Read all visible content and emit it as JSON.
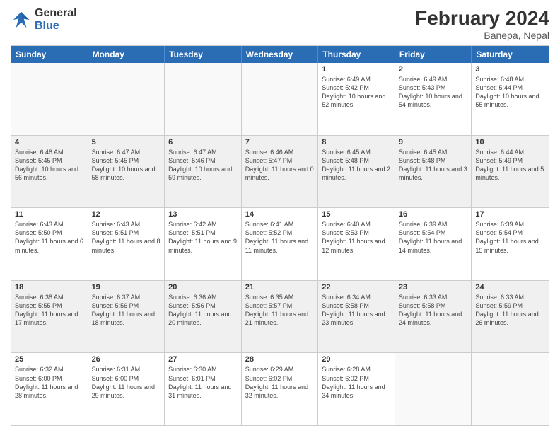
{
  "header": {
    "logo_general": "General",
    "logo_blue": "Blue",
    "title": "February 2024",
    "subtitle": "Banepa, Nepal"
  },
  "days_of_week": [
    "Sunday",
    "Monday",
    "Tuesday",
    "Wednesday",
    "Thursday",
    "Friday",
    "Saturday"
  ],
  "weeks": [
    [
      {
        "day": "",
        "info": ""
      },
      {
        "day": "",
        "info": ""
      },
      {
        "day": "",
        "info": ""
      },
      {
        "day": "",
        "info": ""
      },
      {
        "day": "1",
        "info": "Sunrise: 6:49 AM\nSunset: 5:42 PM\nDaylight: 10 hours and 52 minutes."
      },
      {
        "day": "2",
        "info": "Sunrise: 6:49 AM\nSunset: 5:43 PM\nDaylight: 10 hours and 54 minutes."
      },
      {
        "day": "3",
        "info": "Sunrise: 6:48 AM\nSunset: 5:44 PM\nDaylight: 10 hours and 55 minutes."
      }
    ],
    [
      {
        "day": "4",
        "info": "Sunrise: 6:48 AM\nSunset: 5:45 PM\nDaylight: 10 hours and 56 minutes."
      },
      {
        "day": "5",
        "info": "Sunrise: 6:47 AM\nSunset: 5:45 PM\nDaylight: 10 hours and 58 minutes."
      },
      {
        "day": "6",
        "info": "Sunrise: 6:47 AM\nSunset: 5:46 PM\nDaylight: 10 hours and 59 minutes."
      },
      {
        "day": "7",
        "info": "Sunrise: 6:46 AM\nSunset: 5:47 PM\nDaylight: 11 hours and 0 minutes."
      },
      {
        "day": "8",
        "info": "Sunrise: 6:45 AM\nSunset: 5:48 PM\nDaylight: 11 hours and 2 minutes."
      },
      {
        "day": "9",
        "info": "Sunrise: 6:45 AM\nSunset: 5:48 PM\nDaylight: 11 hours and 3 minutes."
      },
      {
        "day": "10",
        "info": "Sunrise: 6:44 AM\nSunset: 5:49 PM\nDaylight: 11 hours and 5 minutes."
      }
    ],
    [
      {
        "day": "11",
        "info": "Sunrise: 6:43 AM\nSunset: 5:50 PM\nDaylight: 11 hours and 6 minutes."
      },
      {
        "day": "12",
        "info": "Sunrise: 6:43 AM\nSunset: 5:51 PM\nDaylight: 11 hours and 8 minutes."
      },
      {
        "day": "13",
        "info": "Sunrise: 6:42 AM\nSunset: 5:51 PM\nDaylight: 11 hours and 9 minutes."
      },
      {
        "day": "14",
        "info": "Sunrise: 6:41 AM\nSunset: 5:52 PM\nDaylight: 11 hours and 11 minutes."
      },
      {
        "day": "15",
        "info": "Sunrise: 6:40 AM\nSunset: 5:53 PM\nDaylight: 11 hours and 12 minutes."
      },
      {
        "day": "16",
        "info": "Sunrise: 6:39 AM\nSunset: 5:54 PM\nDaylight: 11 hours and 14 minutes."
      },
      {
        "day": "17",
        "info": "Sunrise: 6:39 AM\nSunset: 5:54 PM\nDaylight: 11 hours and 15 minutes."
      }
    ],
    [
      {
        "day": "18",
        "info": "Sunrise: 6:38 AM\nSunset: 5:55 PM\nDaylight: 11 hours and 17 minutes."
      },
      {
        "day": "19",
        "info": "Sunrise: 6:37 AM\nSunset: 5:56 PM\nDaylight: 11 hours and 18 minutes."
      },
      {
        "day": "20",
        "info": "Sunrise: 6:36 AM\nSunset: 5:56 PM\nDaylight: 11 hours and 20 minutes."
      },
      {
        "day": "21",
        "info": "Sunrise: 6:35 AM\nSunset: 5:57 PM\nDaylight: 11 hours and 21 minutes."
      },
      {
        "day": "22",
        "info": "Sunrise: 6:34 AM\nSunset: 5:58 PM\nDaylight: 11 hours and 23 minutes."
      },
      {
        "day": "23",
        "info": "Sunrise: 6:33 AM\nSunset: 5:58 PM\nDaylight: 11 hours and 24 minutes."
      },
      {
        "day": "24",
        "info": "Sunrise: 6:33 AM\nSunset: 5:59 PM\nDaylight: 11 hours and 26 minutes."
      }
    ],
    [
      {
        "day": "25",
        "info": "Sunrise: 6:32 AM\nSunset: 6:00 PM\nDaylight: 11 hours and 28 minutes."
      },
      {
        "day": "26",
        "info": "Sunrise: 6:31 AM\nSunset: 6:00 PM\nDaylight: 11 hours and 29 minutes."
      },
      {
        "day": "27",
        "info": "Sunrise: 6:30 AM\nSunset: 6:01 PM\nDaylight: 11 hours and 31 minutes."
      },
      {
        "day": "28",
        "info": "Sunrise: 6:29 AM\nSunset: 6:02 PM\nDaylight: 11 hours and 32 minutes."
      },
      {
        "day": "29",
        "info": "Sunrise: 6:28 AM\nSunset: 6:02 PM\nDaylight: 11 hours and 34 minutes."
      },
      {
        "day": "",
        "info": ""
      },
      {
        "day": "",
        "info": ""
      }
    ]
  ]
}
